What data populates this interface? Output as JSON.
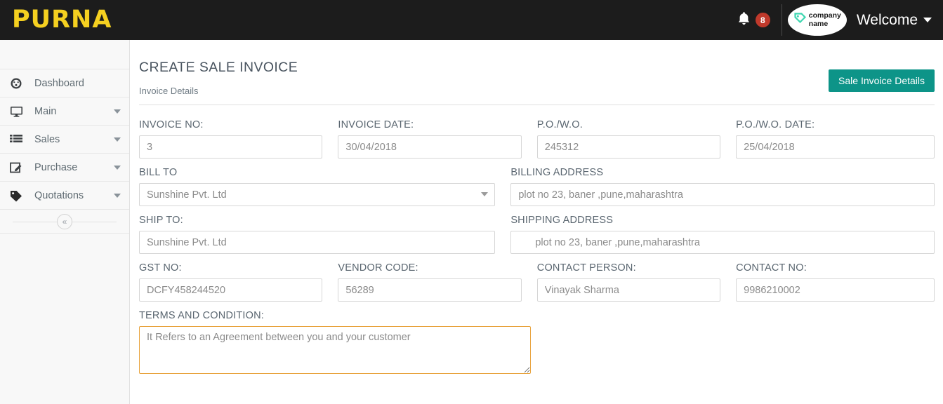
{
  "topbar": {
    "brand": "PURNA",
    "bell_icon": "bell-icon",
    "notification_count": "8",
    "company_logo_text_line1": "company",
    "company_logo_text_line2": "name",
    "welcome_label": "Welcome",
    "caret_icon": "chevron-down-icon",
    "brand_color": "#f5d020",
    "background_color": "#1c1c1c",
    "badge_color": "#c0392b"
  },
  "sidebar": {
    "items": [
      {
        "label": "Dashboard",
        "icon": "dashboard-gauge-icon",
        "has_caret": false
      },
      {
        "label": "Main",
        "icon": "monitor-icon",
        "has_caret": true
      },
      {
        "label": "Sales",
        "icon": "list-icon",
        "has_caret": true
      },
      {
        "label": "Purchase",
        "icon": "edit-square-icon",
        "has_caret": true
      },
      {
        "label": "Quotations",
        "icon": "tag-icon",
        "has_caret": true
      }
    ],
    "collapse_label": "«"
  },
  "main": {
    "page_title": "CREATE SALE INVOICE",
    "subtitle": "Invoice Details",
    "primary_button": "Sale Invoice Details",
    "primary_button_color": "#0d9488",
    "fields": {
      "invoice_no": {
        "label": "INVOICE NO:",
        "value": "3"
      },
      "invoice_date": {
        "label": "INVOICE DATE:",
        "value": "30/04/2018"
      },
      "po_wo": {
        "label": "P.O./W.O.",
        "value": "245312"
      },
      "po_wo_date": {
        "label": "P.O./W.O. DATE:",
        "value": "25/04/2018"
      },
      "bill_to": {
        "label": "BILL TO",
        "value": "Sunshine Pvt. Ltd"
      },
      "billing_address": {
        "label": "BILLING ADDRESS",
        "value": "plot no 23, baner ,pune,maharashtra"
      },
      "ship_to": {
        "label": "SHIP TO:",
        "value": "Sunshine Pvt. Ltd"
      },
      "shipping_address": {
        "label": "SHIPPING ADDRESS",
        "value": "plot no 23, baner ,pune,maharashtra"
      },
      "gst_no": {
        "label": "GST NO:",
        "value": "DCFY458244520"
      },
      "vendor_code": {
        "label": "VENDOR CODE:",
        "value": "56289"
      },
      "contact_person": {
        "label": "CONTACT PERSON:",
        "value": "Vinayak Sharma"
      },
      "contact_no": {
        "label": "CONTACT NO:",
        "value": "9986210002"
      },
      "terms": {
        "label": "TERMS AND CONDITION:",
        "value": "It Refers to an Agreement between you and your customer"
      }
    }
  }
}
